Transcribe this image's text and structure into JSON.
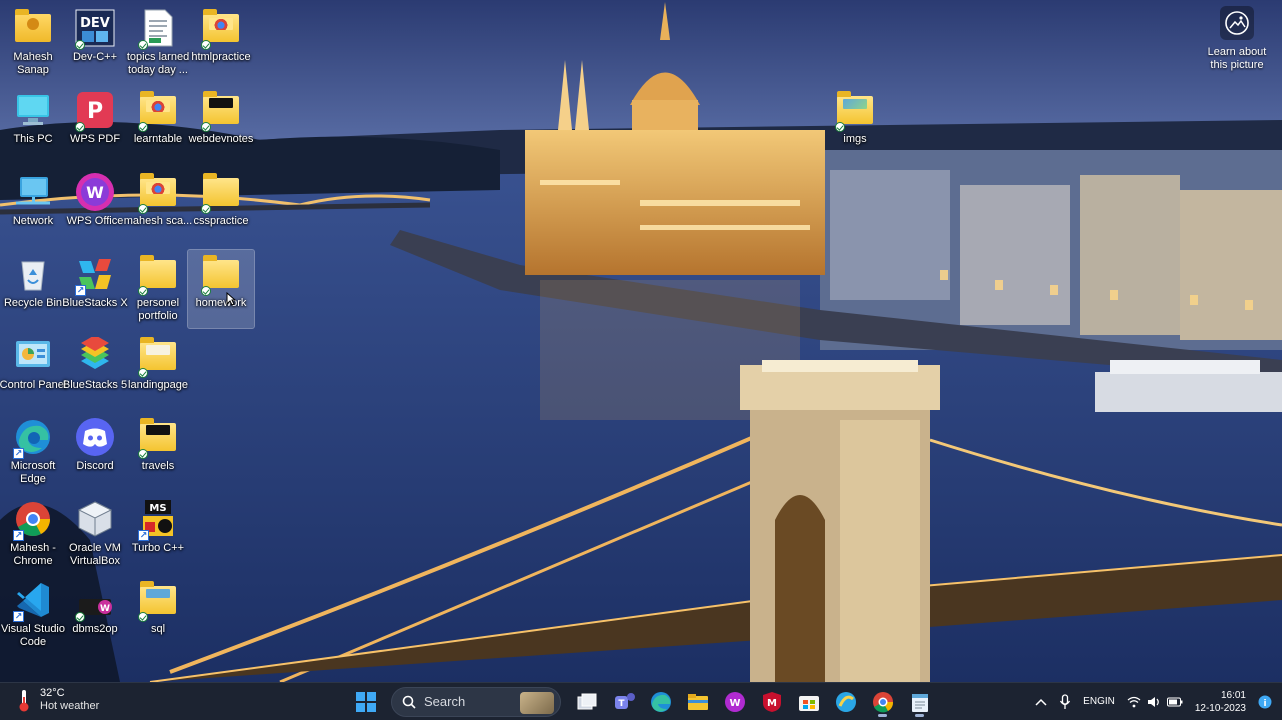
{
  "desktop": {
    "icons": [
      {
        "label": "Mahesh Sanap",
        "icon": "user-folder-icon"
      },
      {
        "label": "Dev-C++",
        "icon": "devcpp-icon"
      },
      {
        "label": "topics larned today day ...",
        "icon": "document-icon"
      },
      {
        "label": "htmlpractice",
        "icon": "folder-icon"
      },
      {
        "label": "This PC",
        "icon": "monitor-icon"
      },
      {
        "label": "WPS PDF",
        "icon": "wps-pdf-icon"
      },
      {
        "label": "learntable",
        "icon": "folder-icon"
      },
      {
        "label": "webdevnotes",
        "icon": "folder-icon"
      },
      {
        "label": "Network",
        "icon": "network-icon"
      },
      {
        "label": "WPS Office",
        "icon": "wps-office-icon"
      },
      {
        "label": "mahesh sca...",
        "icon": "folder-icon"
      },
      {
        "label": "csspractice",
        "icon": "folder-icon"
      },
      {
        "label": "Recycle Bin",
        "icon": "recycle-bin-icon"
      },
      {
        "label": "BlueStacks X",
        "icon": "bluestacks-x-icon"
      },
      {
        "label": "personel portfolio",
        "icon": "folder-icon"
      },
      {
        "label": "homework",
        "icon": "folder-icon"
      },
      {
        "label": "Control Panel",
        "icon": "control-panel-icon"
      },
      {
        "label": "BlueStacks 5",
        "icon": "bluestacks-5-icon"
      },
      {
        "label": "landingpage",
        "icon": "folder-icon"
      },
      {
        "label": "Microsoft Edge",
        "icon": "edge-icon"
      },
      {
        "label": "Discord",
        "icon": "discord-icon"
      },
      {
        "label": "travels",
        "icon": "folder-icon"
      },
      {
        "label": "Mahesh - Chrome",
        "icon": "chrome-icon"
      },
      {
        "label": "Oracle VM VirtualBox",
        "icon": "virtualbox-icon"
      },
      {
        "label": "Turbo C++",
        "icon": "turbo-cpp-icon"
      },
      {
        "label": "Visual Studio Code",
        "icon": "vscode-icon"
      },
      {
        "label": "dbms2op",
        "icon": "dbms-icon"
      },
      {
        "label": "sql",
        "icon": "folder-icon"
      },
      {
        "label": "imgs",
        "icon": "folder-icon"
      }
    ],
    "learn_about": "Learn about this picture"
  },
  "taskbar": {
    "weather": {
      "temp": "32°C",
      "condition": "Hot weather"
    },
    "search_label": "Search",
    "apps": [
      "start-icon",
      "task-view-icon",
      "teams-icon",
      "edge-icon",
      "file-explorer-icon",
      "wps-icon",
      "mcafee-icon",
      "store-icon",
      "settings-app-icon",
      "chrome-icon",
      "notepad-icon"
    ],
    "tray": {
      "lang_line1": "ENG",
      "lang_line2": "IN",
      "time": "16:01",
      "date": "12-10-2023"
    }
  },
  "colors": {
    "taskbar_bg": "#1c2331",
    "sky": "#2d3f72",
    "water": "#26407a",
    "lights": "#f6c46a"
  }
}
